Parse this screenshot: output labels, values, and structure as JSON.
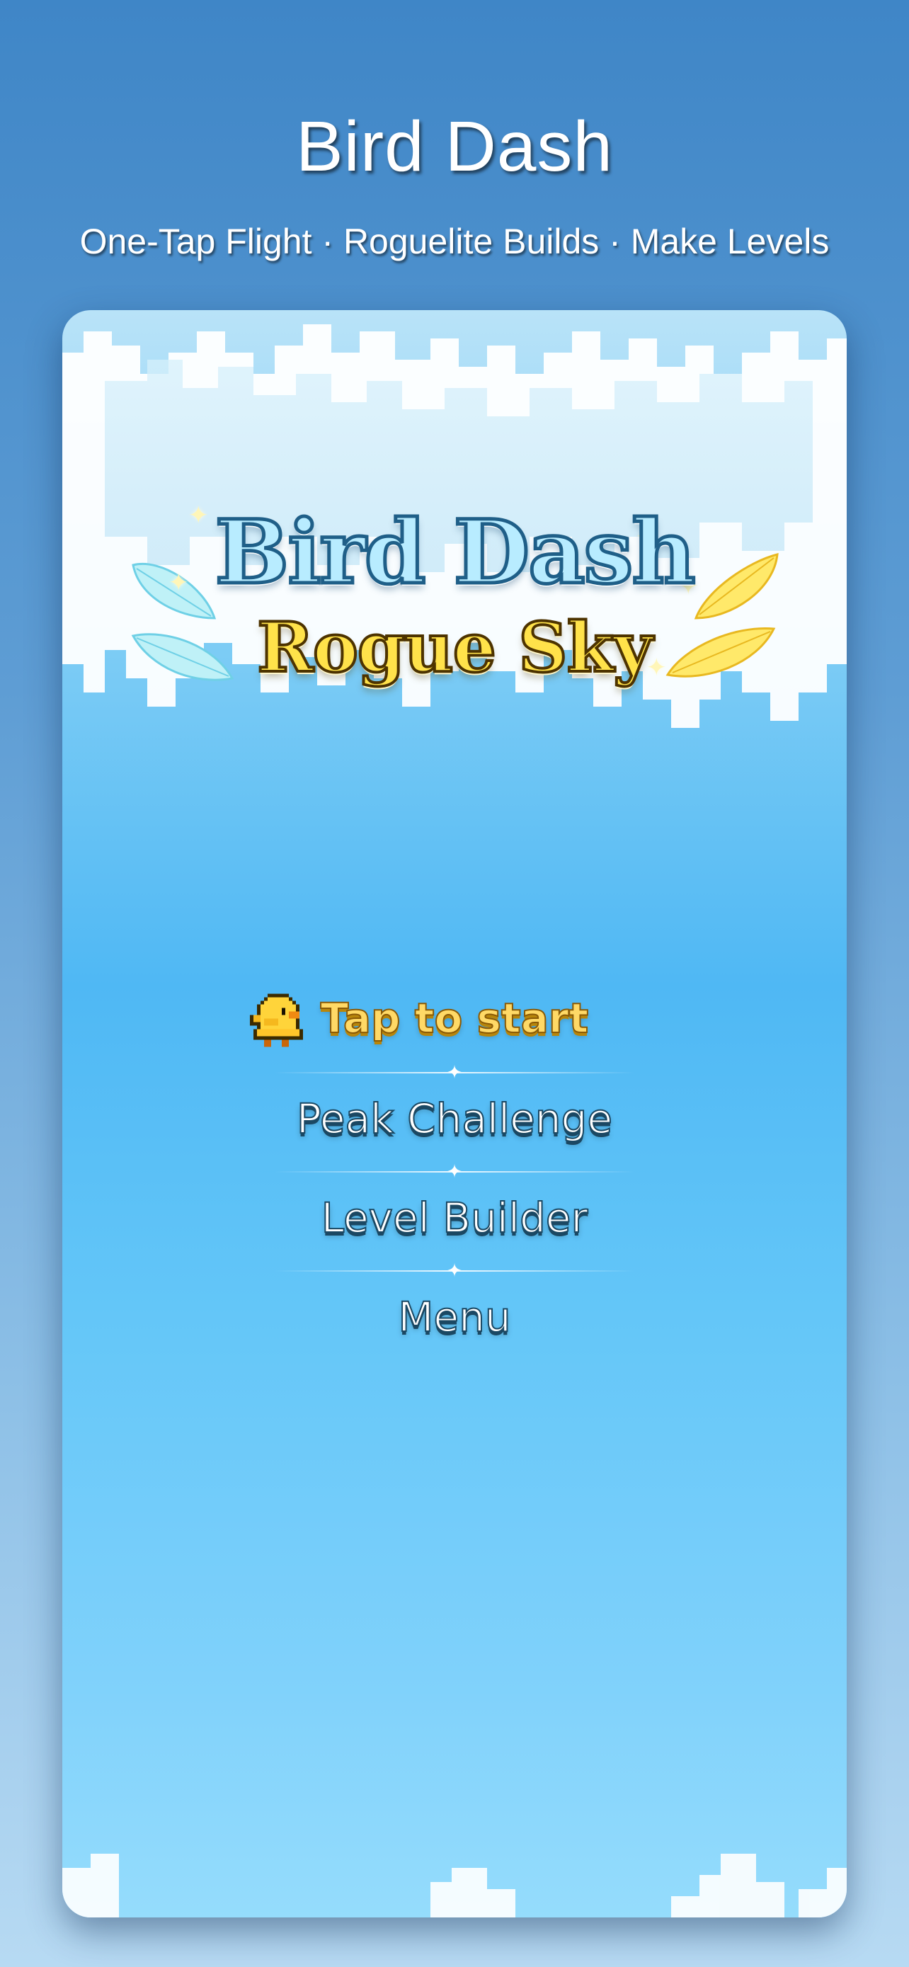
{
  "header": {
    "title": "Bird Dash",
    "subtitle": "One-Tap Flight · Roguelite Builds · Make Levels"
  },
  "game": {
    "logo": {
      "line1": "Bird Dash",
      "line2": "Rogue Sky"
    },
    "menu": {
      "start_label": "Tap to start",
      "items": [
        {
          "label": "Peak Challenge"
        },
        {
          "label": "Level Builder"
        },
        {
          "label": "Menu"
        }
      ]
    },
    "icons": {
      "bird": "chick-icon",
      "divider": "diamond-divider-icon",
      "feathers": "feather-icon"
    }
  },
  "colors": {
    "background_top": "#3f86c7",
    "background_bottom": "#b7daf3",
    "sky": "#4fb8f4",
    "start_text": "#ffd966",
    "logo_blue": "#b8ecff",
    "logo_yellow": "#ffe24a"
  }
}
